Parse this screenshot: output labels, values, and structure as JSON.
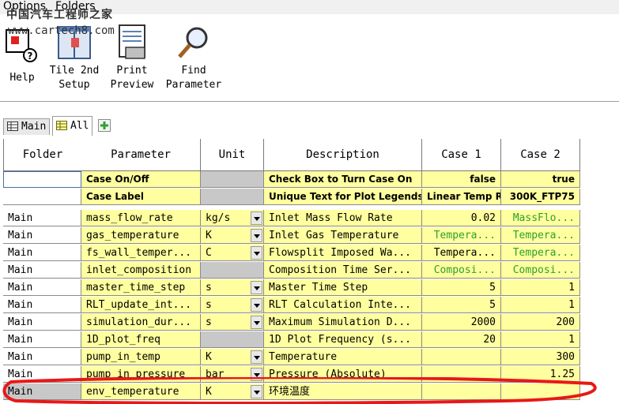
{
  "menu": {
    "options": "Options",
    "folders": "Folders"
  },
  "watermark": {
    "line1": "中国汽车工程师之家",
    "line2": "www.cartech8.com"
  },
  "toolbar": {
    "help": "Help",
    "tile_line1": "Tile 2nd",
    "tile_line2": "Setup",
    "print_line1": "Print",
    "print_line2": "Preview",
    "find_line1": "Find",
    "find_line2": "Parameter"
  },
  "tabs": {
    "main": "Main",
    "all": "All"
  },
  "headers": {
    "folder": "Folder",
    "parameter": "Parameter",
    "unit": "Unit",
    "description": "Description",
    "case1": "Case 1",
    "case2": "Case 2"
  },
  "special_rows": [
    {
      "parameter": "Case On/Off",
      "description": "Check Box to Turn Case On",
      "case1": "false",
      "case2": "true"
    },
    {
      "parameter": "Case Label",
      "description": "Unique Text for Plot Legends",
      "case1": "Linear Temp R...",
      "case2": "300K_FTP75"
    }
  ],
  "rows": [
    {
      "folder": "Main",
      "parameter": "mass_flow_rate",
      "unit": "kg/s",
      "description": "Inlet Mass Flow Rate",
      "case1": "0.02",
      "case2": "MassFlo..."
    },
    {
      "folder": "Main",
      "parameter": "gas_temperature",
      "unit": "K",
      "description": "Inlet Gas Temperature",
      "case1": "Tempera...",
      "case2": "Tempera..."
    },
    {
      "folder": "Main",
      "parameter": "fs_wall_temper...",
      "unit": "C",
      "description": "Flowsplit Imposed Wa...",
      "case1": "Tempera...",
      "case2": "Tempera..."
    },
    {
      "folder": "Main",
      "parameter": "inlet_composition",
      "unit": "",
      "description": "Composition Time Ser...",
      "case1": "Composi...",
      "case2": "Composi..."
    },
    {
      "folder": "Main",
      "parameter": "master_time_step",
      "unit": "s",
      "description": "Master Time Step",
      "case1": "5",
      "case2": "1"
    },
    {
      "folder": "Main",
      "parameter": "RLT_update_int...",
      "unit": "s",
      "description": "RLT Calculation Inte...",
      "case1": "5",
      "case2": "1"
    },
    {
      "folder": "Main",
      "parameter": "simulation_dur...",
      "unit": "s",
      "description": "Maximum Simulation D...",
      "case1": "2000",
      "case2": "200"
    },
    {
      "folder": "Main",
      "parameter": "1D_plot_freq",
      "unit": "",
      "description": "1D Plot Frequency (s...",
      "case1": "20",
      "case2": "1"
    },
    {
      "folder": "Main",
      "parameter": "pump_in_temp",
      "unit": "K",
      "description": "Temperature",
      "case1": "",
      "case2": "300"
    },
    {
      "folder": "Main",
      "parameter": "pump_in_pressure",
      "unit": "bar",
      "description": "Pressure (Absolute)",
      "case1": "",
      "case2": "1.25"
    },
    {
      "folder": "Main",
      "parameter": "env_temperature",
      "unit": "K",
      "description": "环境温度",
      "case1": "",
      "case2": ""
    }
  ],
  "colors": {
    "cell_yellow": "#ffff9f",
    "green_text": "#2ea02e",
    "annotation_red": "#e81818"
  }
}
